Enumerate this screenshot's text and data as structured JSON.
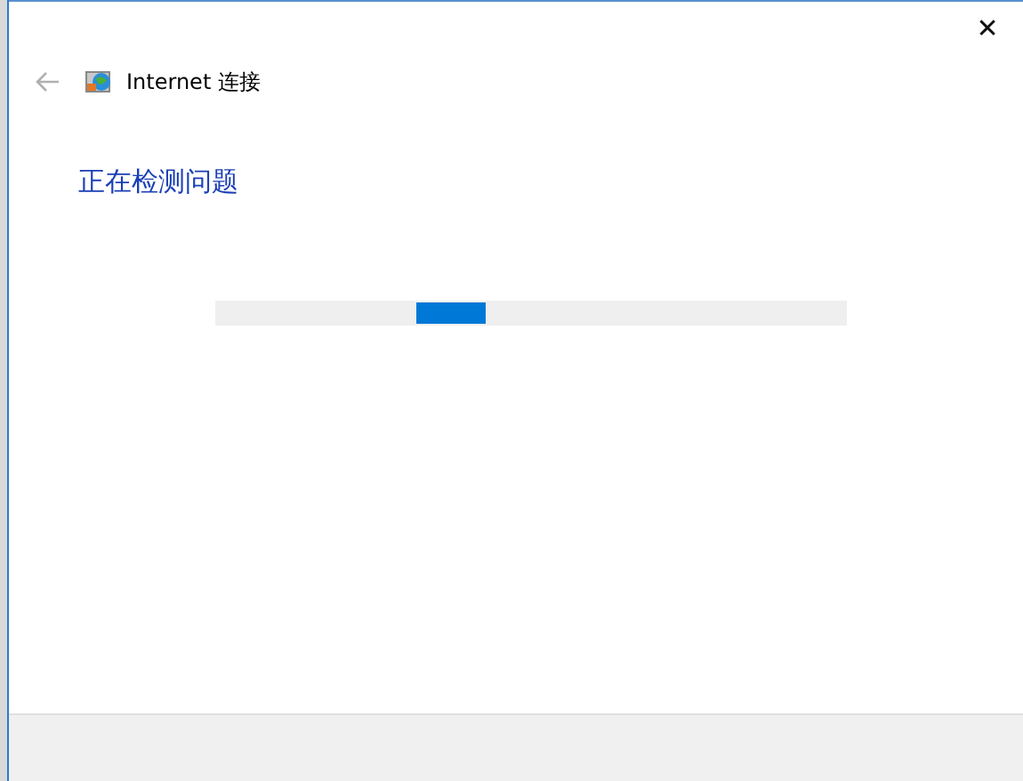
{
  "window": {
    "title": "Internet 连接",
    "close_glyph": "✕"
  },
  "heading": "正在检测问题",
  "progress": {
    "indeterminate": true
  }
}
